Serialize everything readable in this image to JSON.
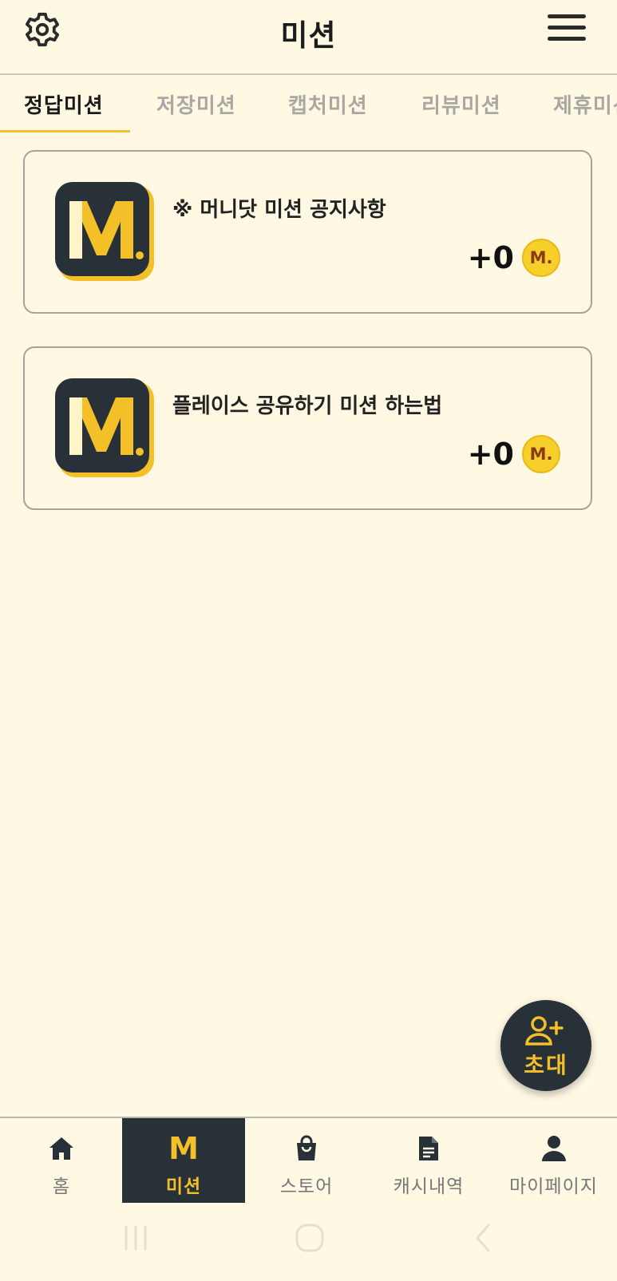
{
  "header": {
    "title": "미션",
    "settings_icon": "gear-icon",
    "menu_icon": "hamburger-menu-icon"
  },
  "tabs": [
    {
      "label": "정답미션",
      "active": true
    },
    {
      "label": "저장미션",
      "active": false
    },
    {
      "label": "캡처미션",
      "active": false
    },
    {
      "label": "리뷰미션",
      "active": false
    },
    {
      "label": "제휴미션",
      "active": false
    }
  ],
  "missions": [
    {
      "title": "※ 머니닷 미션 공지사항",
      "reward": "+0",
      "logo_letter": "M"
    },
    {
      "title": "플레이스 공유하기 미션 하는법",
      "reward": "+0",
      "logo_letter": "M"
    }
  ],
  "coin": {
    "label": "M."
  },
  "fab": {
    "label": "초대",
    "icon": "add-user-icon"
  },
  "bottom_nav": [
    {
      "label": "홈",
      "icon": "home-icon",
      "active": false
    },
    {
      "label": "미션",
      "icon": "mission-m-icon",
      "active": true,
      "glyph": "M"
    },
    {
      "label": "스토어",
      "icon": "shopping-bag-icon",
      "active": false
    },
    {
      "label": "캐시내역",
      "icon": "document-icon",
      "active": false
    },
    {
      "label": "마이페이지",
      "icon": "person-icon",
      "active": false
    }
  ],
  "colors": {
    "background": "#fff8e3",
    "accent": "#f4c02a",
    "dark": "#283137"
  }
}
